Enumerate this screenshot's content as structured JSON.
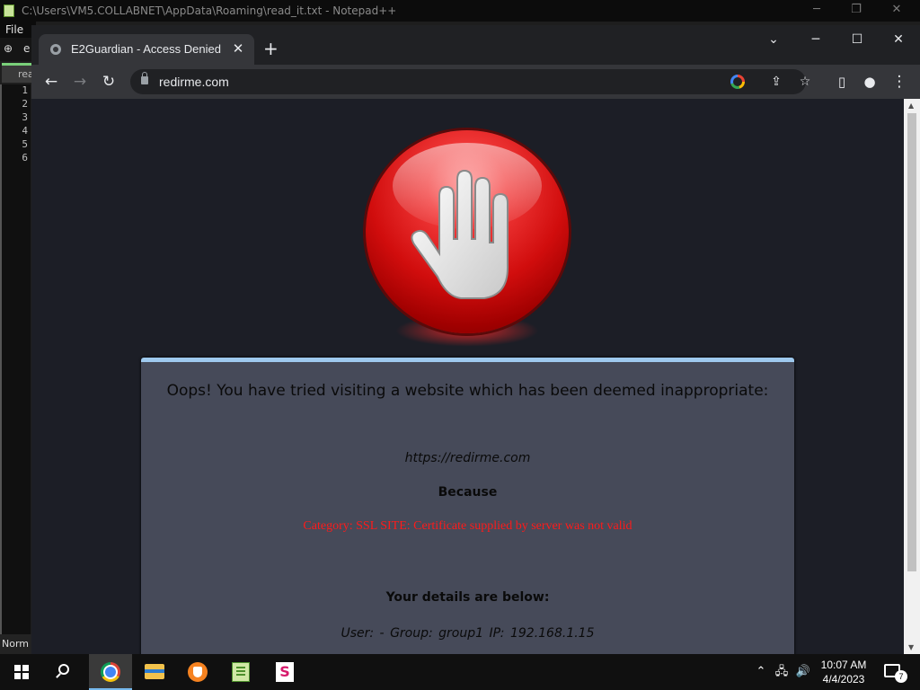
{
  "notepad": {
    "title": "C:\\Users\\VM5.COLLABNET\\AppData\\Roaming\\read_it.txt - Notepad++",
    "menu_file": "File",
    "tab_label": "rea",
    "line_numbers": [
      "1",
      "2",
      "3",
      "4",
      "5",
      "6"
    ],
    "status_mode": "Norm"
  },
  "browser": {
    "tab_title": "E2Guardian - Access Denied",
    "url": "redirme.com"
  },
  "page": {
    "headline": "Oops! You have tried visiting a website which has been deemed inappropriate:",
    "blocked_url": "https://redirme.com",
    "because_label": "Because",
    "reason": "Category: SSL SITE:  Certificate supplied by server was not valid",
    "details_heading": "Your details are below:",
    "user_details": "User: -   Group: group1   IP: 192.168.1.15"
  },
  "taskbar": {
    "clock_time": "10:07 AM",
    "clock_date": "4/4/2023",
    "notification_count": "7"
  },
  "colors": {
    "page_background": "#1c1e26",
    "message_box": "#464a59",
    "message_box_border": "#9ec9ee",
    "reason_text": "#ff1a1a",
    "stop_sign": "#d10d0d"
  },
  "icons": {
    "app_window": "notepadpp-icon",
    "tab_favicon": "globe-icon",
    "site_security": "lock-icon",
    "stop_sign": "stop-hand-icon"
  }
}
